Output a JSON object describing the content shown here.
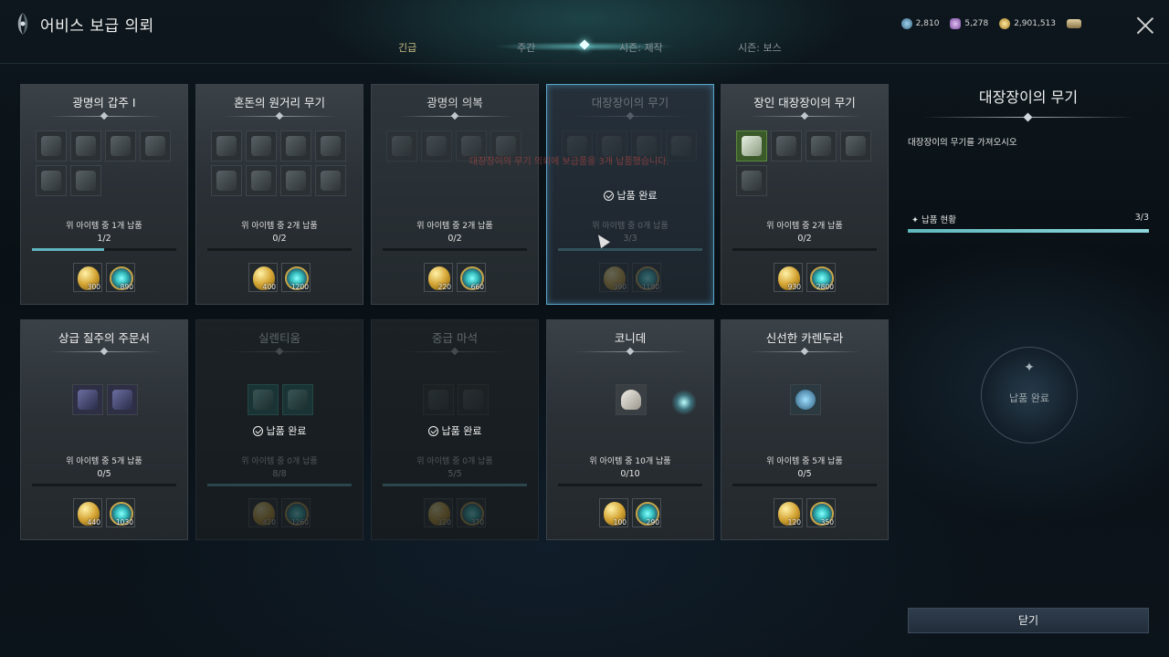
{
  "header": {
    "title": "어비스 보급 의뢰",
    "tabs": [
      {
        "label": "긴급",
        "active": true
      },
      {
        "label": "주간",
        "active": false
      },
      {
        "label": "시즌: 제작",
        "active": false
      },
      {
        "label": "시즌: 보스",
        "active": false
      }
    ],
    "currencies": [
      {
        "icon": "crystal-icon",
        "value": "2,810",
        "color": "#6ea6c8"
      },
      {
        "icon": "purple-gem-icon",
        "value": "5,278",
        "color": "#b58ad0"
      },
      {
        "icon": "gold-coin-icon",
        "value": "2,901,513",
        "color": "#d4a433"
      },
      {
        "icon": "ingot-icon",
        "value": "",
        "color": "#c8b48a"
      }
    ]
  },
  "cards": [
    {
      "title": "광명의 갑주 Ⅰ",
      "requirement": "위 아이템 중 1개 납품",
      "progress": "1/2",
      "progress_fraction": 0.5,
      "rewards": [
        "300",
        "890"
      ],
      "state": "normal",
      "completed_text": ""
    },
    {
      "title": "혼돈의 원거리 무기",
      "requirement": "위 아이템 중 2개 납품",
      "progress": "0/2",
      "progress_fraction": 0,
      "rewards": [
        "400",
        "1200"
      ],
      "state": "normal",
      "completed_text": ""
    },
    {
      "title": "광명의 의복",
      "requirement": "위 아이템 중 2개 납품",
      "progress": "0/2",
      "progress_fraction": 0,
      "rewards": [
        "220",
        "660"
      ],
      "state": "normal",
      "completed_text": ""
    },
    {
      "title": "대장장이의 무기",
      "requirement": "위 아이템 중 0개 납품",
      "progress": "3/3",
      "progress_fraction": 1,
      "rewards": [
        "390",
        "1180"
      ],
      "state": "completed-selected",
      "completed_text": "납품 완료"
    },
    {
      "title": "장인 대장장이의 무기",
      "requirement": "위 아이템 중 2개 납품",
      "progress": "0/2",
      "progress_fraction": 0,
      "rewards": [
        "930",
        "2800"
      ],
      "state": "normal",
      "completed_text": ""
    },
    {
      "title": "상급 질주의 주문서",
      "requirement": "위 아이템 중 5개 납품",
      "progress": "0/5",
      "progress_fraction": 0,
      "rewards": [
        "440",
        "1030"
      ],
      "state": "normal",
      "completed_text": ""
    },
    {
      "title": "실렌티움",
      "requirement": "위 아이템 중 0개 납품",
      "progress": "8/8",
      "progress_fraction": 1,
      "rewards": [
        "420",
        "1260"
      ],
      "state": "completed",
      "completed_text": "납품 완료"
    },
    {
      "title": "중급 마석",
      "requirement": "위 아이템 중 0개 납품",
      "progress": "5/5",
      "progress_fraction": 1,
      "rewards": [
        "120",
        "370"
      ],
      "state": "completed",
      "completed_text": "납품 완료"
    },
    {
      "title": "코니데",
      "requirement": "위 아이템 중 10개 납품",
      "progress": "0/10",
      "progress_fraction": 0,
      "rewards": [
        "100",
        "290"
      ],
      "state": "normal",
      "completed_text": ""
    },
    {
      "title": "신선한 카렌두라",
      "requirement": "위 아이템 중 5개 납품",
      "progress": "0/5",
      "progress_fraction": 0,
      "rewards": [
        "120",
        "350"
      ],
      "state": "normal",
      "completed_text": ""
    }
  ],
  "overlay_message": "대장장이의 무기 의뢰에 보급품을 3개 납품했습니다.",
  "panel": {
    "title": "대장장이의 무기",
    "description": "대장장이의 무기를 가져오시오",
    "status_label": "납품 현황",
    "status_value": "3/3",
    "status_fraction": 1,
    "seal_text": "납품 완료",
    "close_label": "닫기"
  }
}
